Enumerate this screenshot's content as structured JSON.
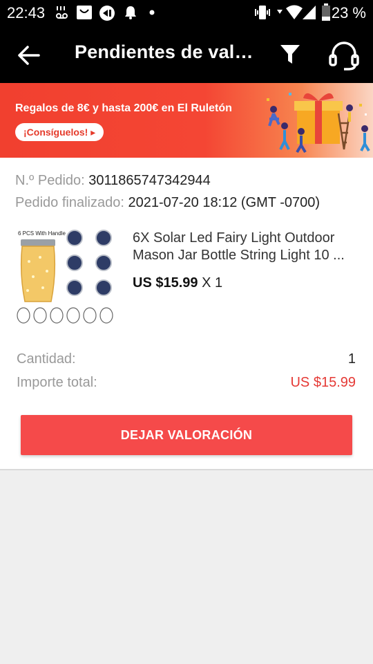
{
  "status_bar": {
    "time": "22:43",
    "battery_percent": "23 %",
    "icons": [
      "voicemail-icon",
      "tablet-icon",
      "speed-icon",
      "notification-bell-icon",
      "dot-icon",
      "vibrate-icon",
      "wifi-icon",
      "signal-icon",
      "battery-icon"
    ]
  },
  "app_bar": {
    "title": "Pendientes de valoración",
    "icons": [
      "back-arrow-icon",
      "filter-icon",
      "headset-support-icon"
    ]
  },
  "banner": {
    "headline": "Regalos de 8€ y hasta 200€ en El Ruletón",
    "cta": "¡Consíguelos! ▸"
  },
  "order": {
    "number_label": "N.º Pedido:",
    "number_value": "3011865747342944",
    "completed_label": "Pedido finalizado:",
    "completed_value": "2021-07-20 18:12 (GMT -0700)",
    "product": {
      "image_caption": "6 PCS With Handle",
      "title_line1": "6X Solar Led Fairy Light Outdoor",
      "title_line2": "Mason Jar Bottle String Light 10 ...",
      "price": "US $15.99",
      "quantity": "X 1"
    },
    "quantity_label": "Cantidad:",
    "quantity_value": "1",
    "total_label": "Importe total:",
    "total_value": "US $15.99",
    "rate_button": "DEJAR VALORACIÓN"
  },
  "colors": {
    "accent_red": "#f54a4a",
    "price_red": "#e53935",
    "appbar": "#000000"
  }
}
